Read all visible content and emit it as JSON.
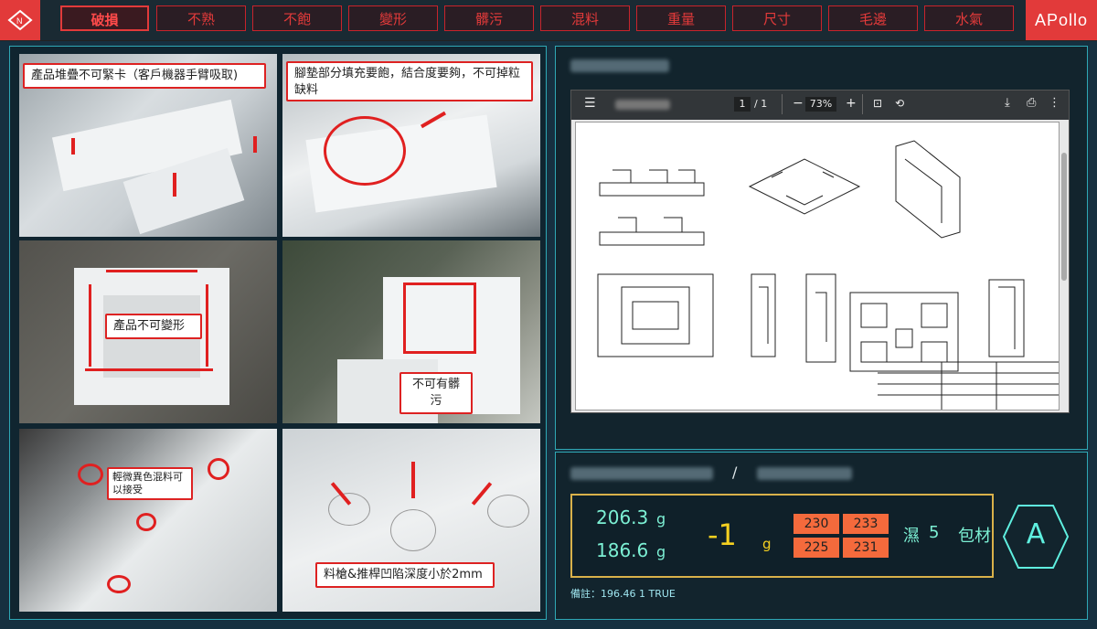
{
  "header": {
    "tabs": [
      {
        "label": "破損",
        "active": true
      },
      {
        "label": "不熟",
        "active": false
      },
      {
        "label": "不飽",
        "active": false
      },
      {
        "label": "變形",
        "active": false
      },
      {
        "label": "髒污",
        "active": false
      },
      {
        "label": "混料",
        "active": false
      },
      {
        "label": "重量",
        "active": false
      },
      {
        "label": "尺寸",
        "active": false
      },
      {
        "label": "毛邊",
        "active": false
      },
      {
        "label": "水氣",
        "active": false
      }
    ],
    "brand": "APollo",
    "logo_icon": "n-diamond-icon"
  },
  "photos": {
    "p1": "產品堆疊不可緊卡（客戶機器手臂吸取)",
    "p2": "腳墊部分填充要飽，結合度要夠，不可掉粒缺料",
    "p3": "產品不可變形",
    "p4": "不可有髒污",
    "p5": "輕微異色混料可以接受",
    "p6": "料槍&推桿凹陷深度小於2mm"
  },
  "pdf": {
    "page": "1",
    "page_total": "/ 1",
    "zoom": "73%",
    "icons": [
      "menu-icon",
      "minus-icon",
      "plus-icon",
      "fit-page-icon",
      "rotate-icon",
      "download-icon",
      "print-icon",
      "more-icon"
    ]
  },
  "measure": {
    "separator": "/",
    "w1": "206.3",
    "w2": "186.6",
    "unit": "g",
    "diff": "-1",
    "diff_unit": "g",
    "boxes": [
      "230",
      "233",
      "225",
      "231"
    ],
    "status_label": "濕",
    "status_value": "5",
    "material": "包材",
    "grade": "A",
    "note": "備註：196.46 1 TRUE"
  },
  "colors": {
    "accent": "#e23a3a",
    "border": "#2fa8b5",
    "value": "#7cf0d4",
    "diff": "#f5d020",
    "box": "#f46a3c"
  }
}
